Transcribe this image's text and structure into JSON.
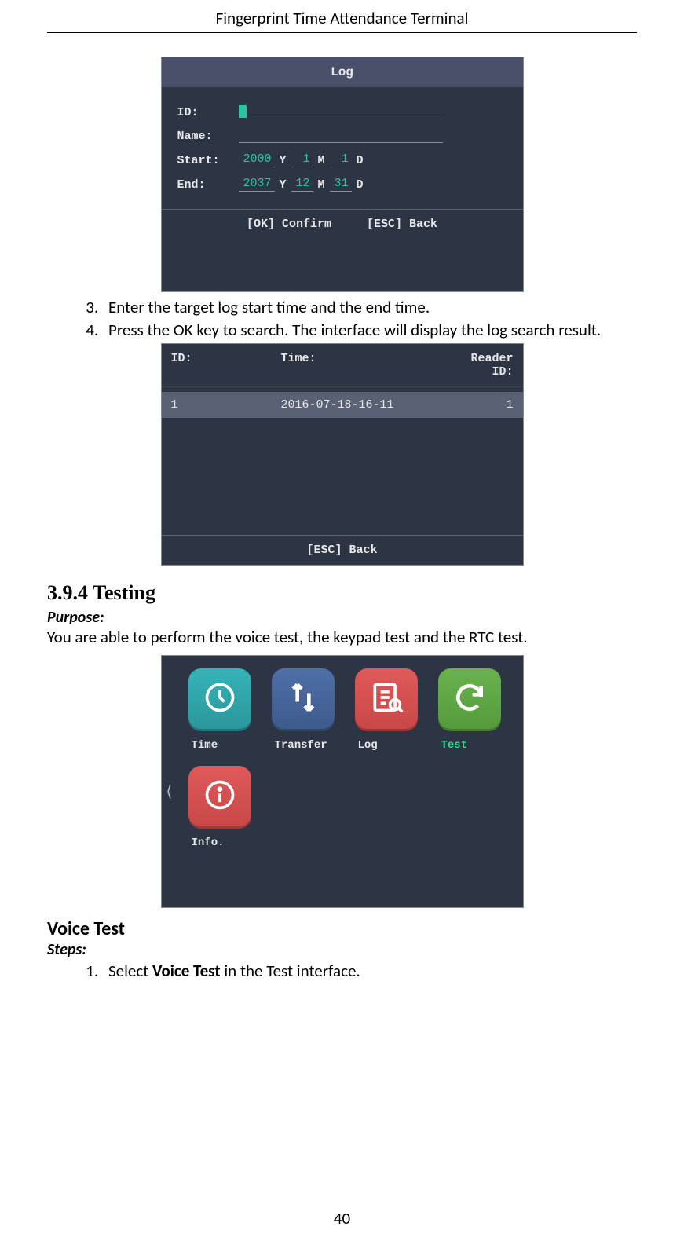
{
  "header": {
    "title": "Fingerprint Time Attendance Terminal"
  },
  "log_screen": {
    "title": "Log",
    "fields": {
      "id_label": "ID:",
      "name_label": "Name:",
      "start_label": "Start:",
      "end_label": "End:"
    },
    "start": {
      "y": "2000",
      "m": "1",
      "d": "1"
    },
    "end": {
      "y": "2037",
      "m": "12",
      "d": "31"
    },
    "units": {
      "y": "Y",
      "m": "M",
      "d": "D"
    },
    "footer_ok": "[OK] Confirm",
    "footer_esc": "[ESC] Back"
  },
  "steps": {
    "s3": "Enter the target log start time and the end time.",
    "s4": "Press the OK key to search. The interface will display the log search result."
  },
  "result_screen": {
    "head": {
      "id": "ID:",
      "time": "Time:",
      "rid": "Reader ID:"
    },
    "row": {
      "id": "1",
      "time": "2016-07-18-16-11",
      "rid": "1"
    },
    "footer": "[ESC] Back"
  },
  "section": {
    "num_title": "3.9.4 Testing",
    "purpose_label": "Purpose:",
    "purpose_text": "You are able to perform the voice test, the keypad test and the RTC test."
  },
  "menu": {
    "items": [
      {
        "label": "Time",
        "color": "t-teal",
        "icon": "clock",
        "selected": false
      },
      {
        "label": "Transfer",
        "color": "t-blue",
        "icon": "transfer",
        "selected": false
      },
      {
        "label": "Log",
        "color": "t-red",
        "icon": "log",
        "selected": false
      },
      {
        "label": "Test",
        "color": "t-green",
        "icon": "refresh",
        "selected": true
      },
      {
        "label": "Info.",
        "color": "t-red2",
        "icon": "info",
        "selected": false
      }
    ]
  },
  "voice": {
    "heading": "Voice Test",
    "steps_label": "Steps:",
    "step1_pre": "Select ",
    "step1_bold": "Voice Test",
    "step1_post": " in the Test interface."
  },
  "page_number": "40"
}
